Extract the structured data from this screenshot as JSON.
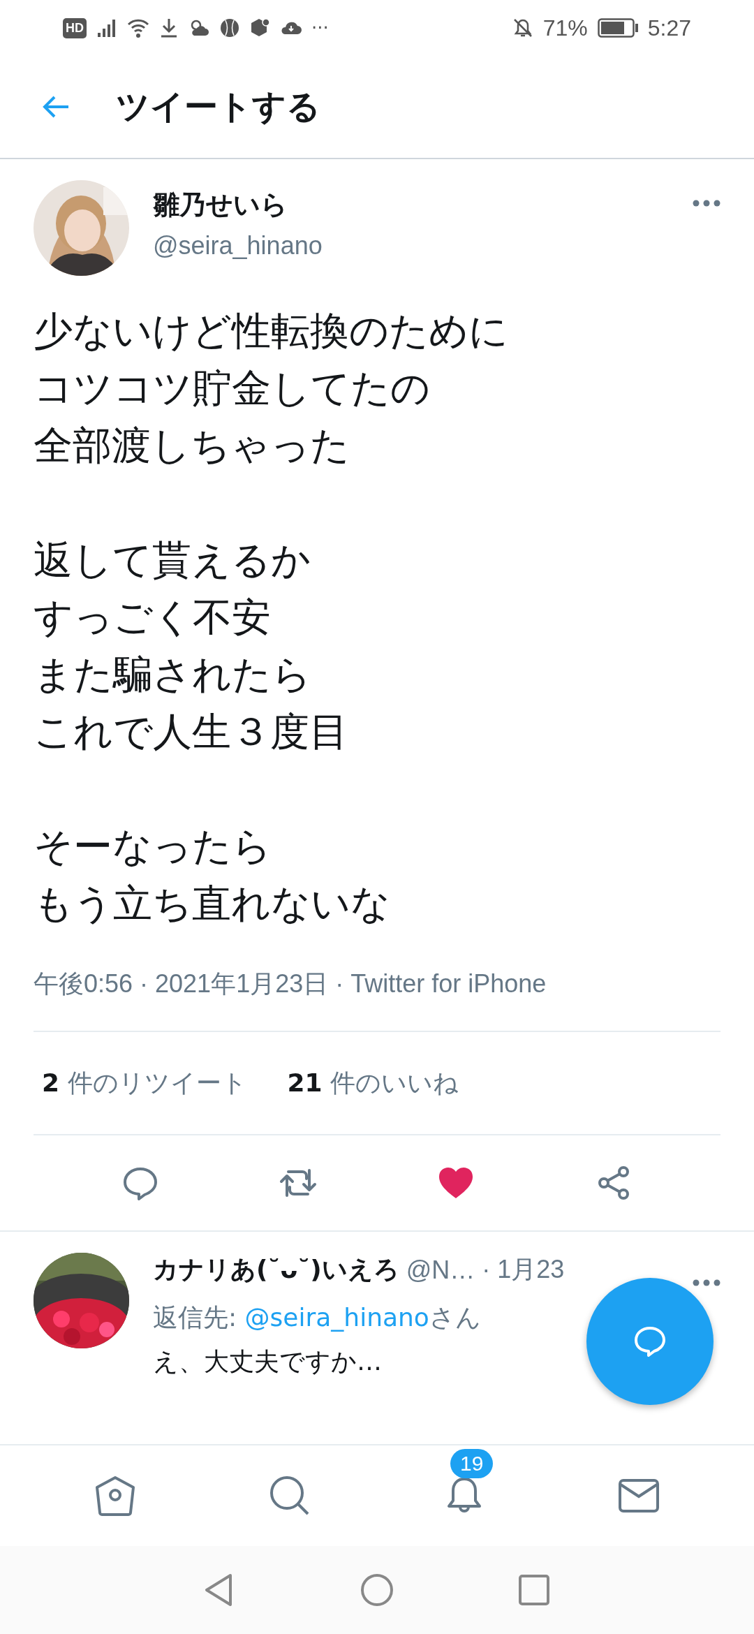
{
  "status_bar": {
    "hd_badge": "HD",
    "more": "···",
    "battery_text": "71%",
    "time": "5:27"
  },
  "header": {
    "title": "ツイートする"
  },
  "tweet": {
    "name": "雛乃せいら",
    "handle": "@seira_hinano",
    "paragraphs": [
      [
        "少ないけど性転換のために",
        "コツコツ貯金してたの",
        "全部渡しちゃった"
      ],
      [
        "返して貰えるか",
        "すっごく不安",
        "また騙されたら",
        "これで人生３度目"
      ],
      [
        "そーなったら",
        "もう立ち直れないな"
      ]
    ],
    "meta": "午後0:56 · 2021年1月23日 · Twitter for iPhone",
    "stats": [
      {
        "count": "2",
        "label": "件のリツイート"
      },
      {
        "count": "21",
        "label": "件のいいね"
      }
    ],
    "liked": true
  },
  "reply": {
    "name": "カナリあ(˘ᴗ˘)いえろ",
    "handle": "@N…",
    "date": "· 1月23",
    "reply_to_label": "返信先: ",
    "reply_to_handle": "@seira_hinano",
    "reply_to_suffix": "さん",
    "text": "え、大丈夫ですか…"
  },
  "bottom_nav": {
    "notification_count": "19"
  }
}
